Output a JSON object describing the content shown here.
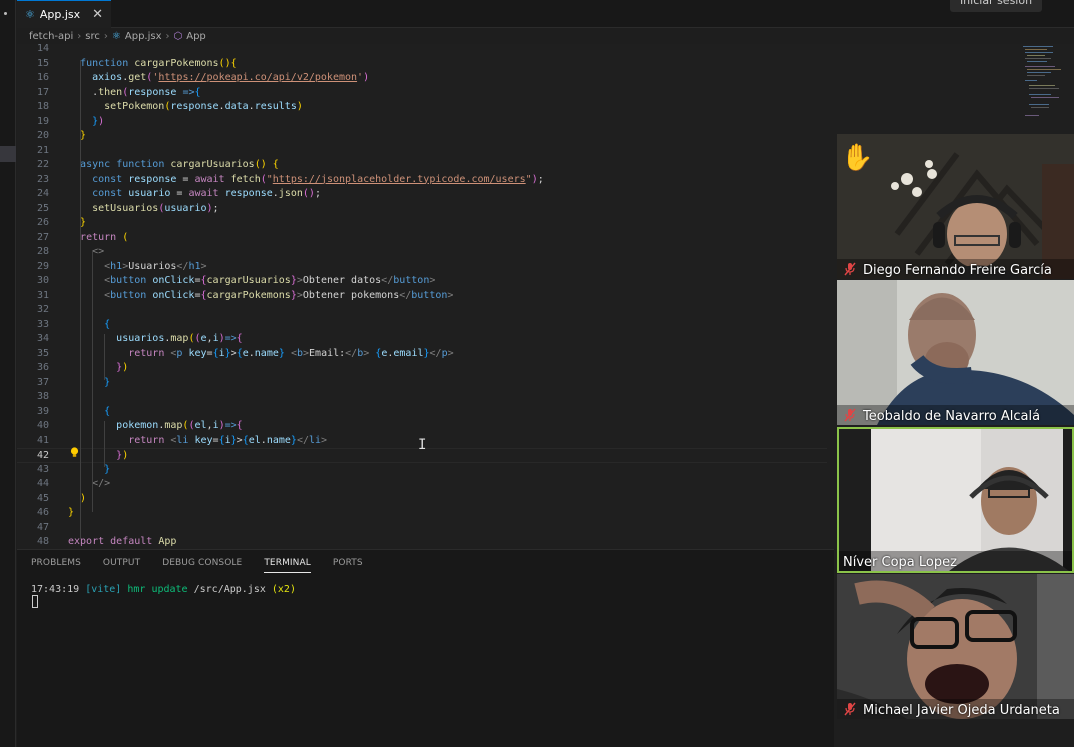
{
  "tab": {
    "filename": "App.jsx",
    "close": "✕"
  },
  "header": {
    "signin_label": "Iniciar sesión"
  },
  "breadcrumb": [
    "fetch-api",
    "src",
    "App.jsx",
    "App"
  ],
  "editor": {
    "lines": [
      {
        "n": "14",
        "html": ""
      },
      {
        "n": "15",
        "html": "  <span class='kw'>function</span> <span class='fn'>cargarPokemons</span><span class='br1'>(){</span>"
      },
      {
        "n": "16",
        "html": "    <span class='vr'>axios</span>.<span class='fn'>get</span><span class='br2'>(</span><span class='str'>'</span><span class='url'>https://pokeapi.co/api/v2/pokemon</span><span class='str'>'</span><span class='br2'>)</span>"
      },
      {
        "n": "17",
        "html": "    .<span class='fn'>then</span><span class='br2'>(</span><span class='vr'>response</span> <span class='kw'>=&gt;</span><span class='br3'>{</span>"
      },
      {
        "n": "18",
        "html": "      <span class='fn'>setPokemon</span><span class='br1'>(</span><span class='vr'>response</span>.<span class='vr'>data</span>.<span class='vr'>results</span><span class='br1'>)</span>"
      },
      {
        "n": "19",
        "html": "    <span class='br3'>}</span><span class='br2'>)</span>"
      },
      {
        "n": "20",
        "html": "  <span class='br1'>}</span>"
      },
      {
        "n": "21",
        "html": ""
      },
      {
        "n": "22",
        "html": "  <span class='kw'>async</span> <span class='kw'>function</span> <span class='fn'>cargarUsuarios</span><span class='br1'>()</span> <span class='br1'>{</span>"
      },
      {
        "n": "23",
        "html": "    <span class='kw'>const</span> <span class='vr'>response</span> = <span class='ctl'>await</span> <span class='fn'>fetch</span><span class='br2'>(</span><span class='str'>\"</span><span class='url'>https://jsonplaceholder.typicode.com/users</span><span class='str'>\"</span><span class='br2'>)</span>;"
      },
      {
        "n": "24",
        "html": "    <span class='kw'>const</span> <span class='vr'>usuario</span> = <span class='ctl'>await</span> <span class='vr'>response</span>.<span class='fn'>json</span><span class='br2'>()</span>;"
      },
      {
        "n": "25",
        "html": "    <span class='fn'>setUsuarios</span><span class='br2'>(</span><span class='vr'>usuario</span><span class='br2'>)</span>;"
      },
      {
        "n": "26",
        "html": "  <span class='br1'>}</span>"
      },
      {
        "n": "27",
        "html": "  <span class='ctl'>return</span> <span class='br1'>(</span>"
      },
      {
        "n": "28",
        "html": "    <span class='gr'>&lt;&gt;</span>"
      },
      {
        "n": "29",
        "html": "      <span class='gr'>&lt;</span><span class='tag'>h1</span><span class='gr'>&gt;</span>Usuarios<span class='gr'>&lt;/</span><span class='tag'>h1</span><span class='gr'>&gt;</span>"
      },
      {
        "n": "30",
        "html": "      <span class='gr'>&lt;</span><span class='tag'>button</span> <span class='vr'>onClick</span>=<span class='br2'>{</span><span class='fn'>cargarUsuarios</span><span class='br2'>}</span><span class='gr'>&gt;</span>Obtener datos<span class='gr'>&lt;/</span><span class='tag'>button</span><span class='gr'>&gt;</span>"
      },
      {
        "n": "31",
        "html": "      <span class='gr'>&lt;</span><span class='tag'>button</span> <span class='vr'>onClick</span>=<span class='br2'>{</span><span class='fn'>cargarPokemons</span><span class='br2'>}</span><span class='gr'>&gt;</span>Obtener pokemons<span class='gr'>&lt;/</span><span class='tag'>button</span><span class='gr'>&gt;</span>"
      },
      {
        "n": "32",
        "html": ""
      },
      {
        "n": "33",
        "html": "      <span class='br3'>{</span>"
      },
      {
        "n": "34",
        "html": "        <span class='vr'>usuarios</span>.<span class='fn'>map</span><span class='br1'>(</span><span class='br2'>(</span><span class='vr'>e</span>,<span class='vr'>i</span><span class='br2'>)</span><span class='kw'>=&gt;</span><span class='br2'>{</span>"
      },
      {
        "n": "35",
        "html": "          <span class='ctl'>return</span> <span class='gr'>&lt;</span><span class='tag'>p</span> <span class='vr'>key</span>=<span class='br3'>{</span><span class='vr'>i</span><span class='br3'>}</span>&gt;<span class='br3'>{</span><span class='vr'>e</span>.<span class='vr'>name</span><span class='br3'>}</span> <span class='gr'>&lt;</span><span class='tag'>b</span><span class='gr'>&gt;</span>Email:<span class='gr'>&lt;/</span><span class='tag'>b</span><span class='gr'>&gt;</span> <span class='br3'>{</span><span class='vr'>e</span>.<span class='vr'>email</span><span class='br3'>}</span><span class='gr'>&lt;/</span><span class='tag'>p</span><span class='gr'>&gt;</span>"
      },
      {
        "n": "36",
        "html": "        <span class='br2'>}</span><span class='br1'>)</span>"
      },
      {
        "n": "37",
        "html": "      <span class='br3'>}</span>"
      },
      {
        "n": "38",
        "html": ""
      },
      {
        "n": "39",
        "html": "      <span class='br3'>{</span>"
      },
      {
        "n": "40",
        "html": "        <span class='vr'>pokemon</span>.<span class='fn'>map</span><span class='br1'>(</span><span class='br2'>(</span><span class='vr'>el</span>,<span class='vr'>i</span><span class='br2'>)</span><span class='kw'>=&gt;</span><span class='br2'>{</span>"
      },
      {
        "n": "41",
        "html": "          <span class='ctl'>return</span> <span class='gr'>&lt;</span><span class='tag'>li</span> <span class='vr'>key</span>=<span class='br3'>{</span><span class='vr'>i</span><span class='br3'>}</span>&gt;<span class='br3'>{</span><span class='vr'>el</span>.<span class='vr'>name</span><span class='br3'>}</span><span class='gr'>&lt;/</span><span class='tag'>li</span><span class='gr'>&gt;</span>"
      },
      {
        "n": "42",
        "html": "        <span class='br2'>}</span><span class='br1'>)</span>",
        "active": true
      },
      {
        "n": "43",
        "html": "      <span class='br3'>}</span>"
      },
      {
        "n": "44",
        "html": "    <span class='gr'>&lt;/&gt;</span>"
      },
      {
        "n": "45",
        "html": "  <span class='br1'>)</span>"
      },
      {
        "n": "46",
        "html": "<span class='br1'>}</span>"
      },
      {
        "n": "47",
        "html": ""
      },
      {
        "n": "48",
        "html": "<span class='ctl'>export</span> <span class='ctl'>default</span> <span class='fn'>App</span>"
      }
    ]
  },
  "panel": {
    "tabs": [
      "PROBLEMS",
      "OUTPUT",
      "DEBUG CONSOLE",
      "TERMINAL",
      "PORTS"
    ],
    "selected": "TERMINAL",
    "terminal": {
      "time": "17:43:19",
      "tool": "[vite]",
      "event": "hmr update",
      "path": "/src/App.jsx",
      "count": "(x2)"
    }
  },
  "participants": [
    {
      "name": "Diego Fernando Freire García",
      "muted": true,
      "hand_raised": true
    },
    {
      "name": "Teobaldo de Navarro Alcalá",
      "muted": true
    },
    {
      "name": "Níver Copa Lopez",
      "muted": false,
      "speaking": true
    },
    {
      "name": "Michael Javier Ojeda Urdaneta",
      "muted": true
    }
  ]
}
